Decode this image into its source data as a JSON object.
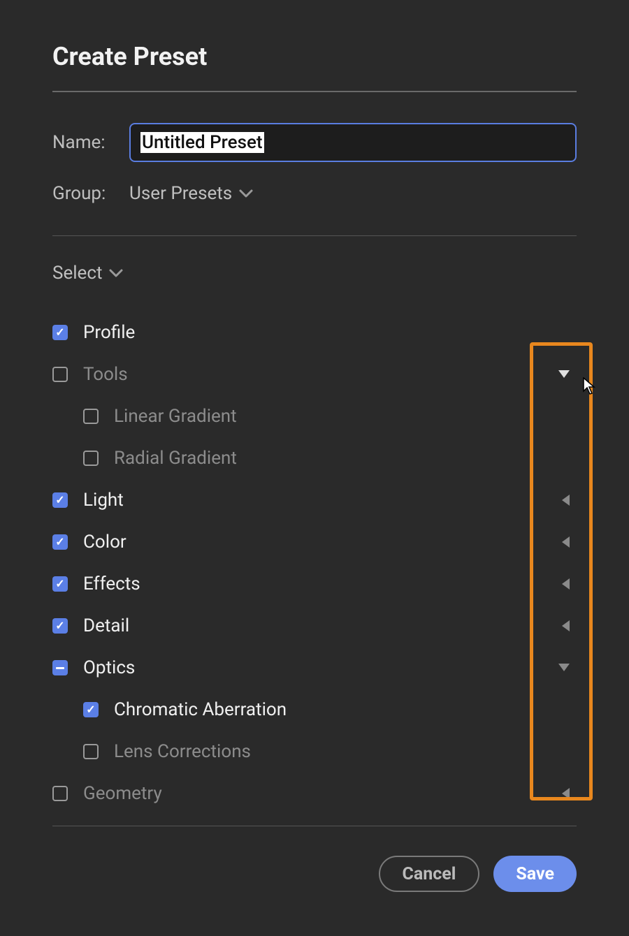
{
  "title": "Create Preset",
  "name_label": "Name:",
  "name_value": "Untitled Preset",
  "group_label": "Group:",
  "group_value": "User Presets",
  "select_label": "Select",
  "items": {
    "profile": {
      "label": "Profile",
      "state": "checked",
      "arrow": "none"
    },
    "tools": {
      "label": "Tools",
      "state": "unchecked",
      "arrow": "down"
    },
    "linear": {
      "label": "Linear Gradient",
      "state": "unchecked",
      "arrow": "none"
    },
    "radial": {
      "label": "Radial Gradient",
      "state": "unchecked",
      "arrow": "none"
    },
    "light": {
      "label": "Light",
      "state": "checked",
      "arrow": "left"
    },
    "color": {
      "label": "Color",
      "state": "checked",
      "arrow": "left"
    },
    "effects": {
      "label": "Effects",
      "state": "checked",
      "arrow": "left"
    },
    "detail": {
      "label": "Detail",
      "state": "checked",
      "arrow": "left"
    },
    "optics": {
      "label": "Optics",
      "state": "indeterminate",
      "arrow": "down"
    },
    "chromab": {
      "label": "Chromatic Aberration",
      "state": "checked",
      "arrow": "none"
    },
    "lenscor": {
      "label": "Lens Corrections",
      "state": "unchecked",
      "arrow": "none"
    },
    "geometry": {
      "label": "Geometry",
      "state": "unchecked",
      "arrow": "left"
    }
  },
  "buttons": {
    "cancel": "Cancel",
    "save": "Save"
  }
}
